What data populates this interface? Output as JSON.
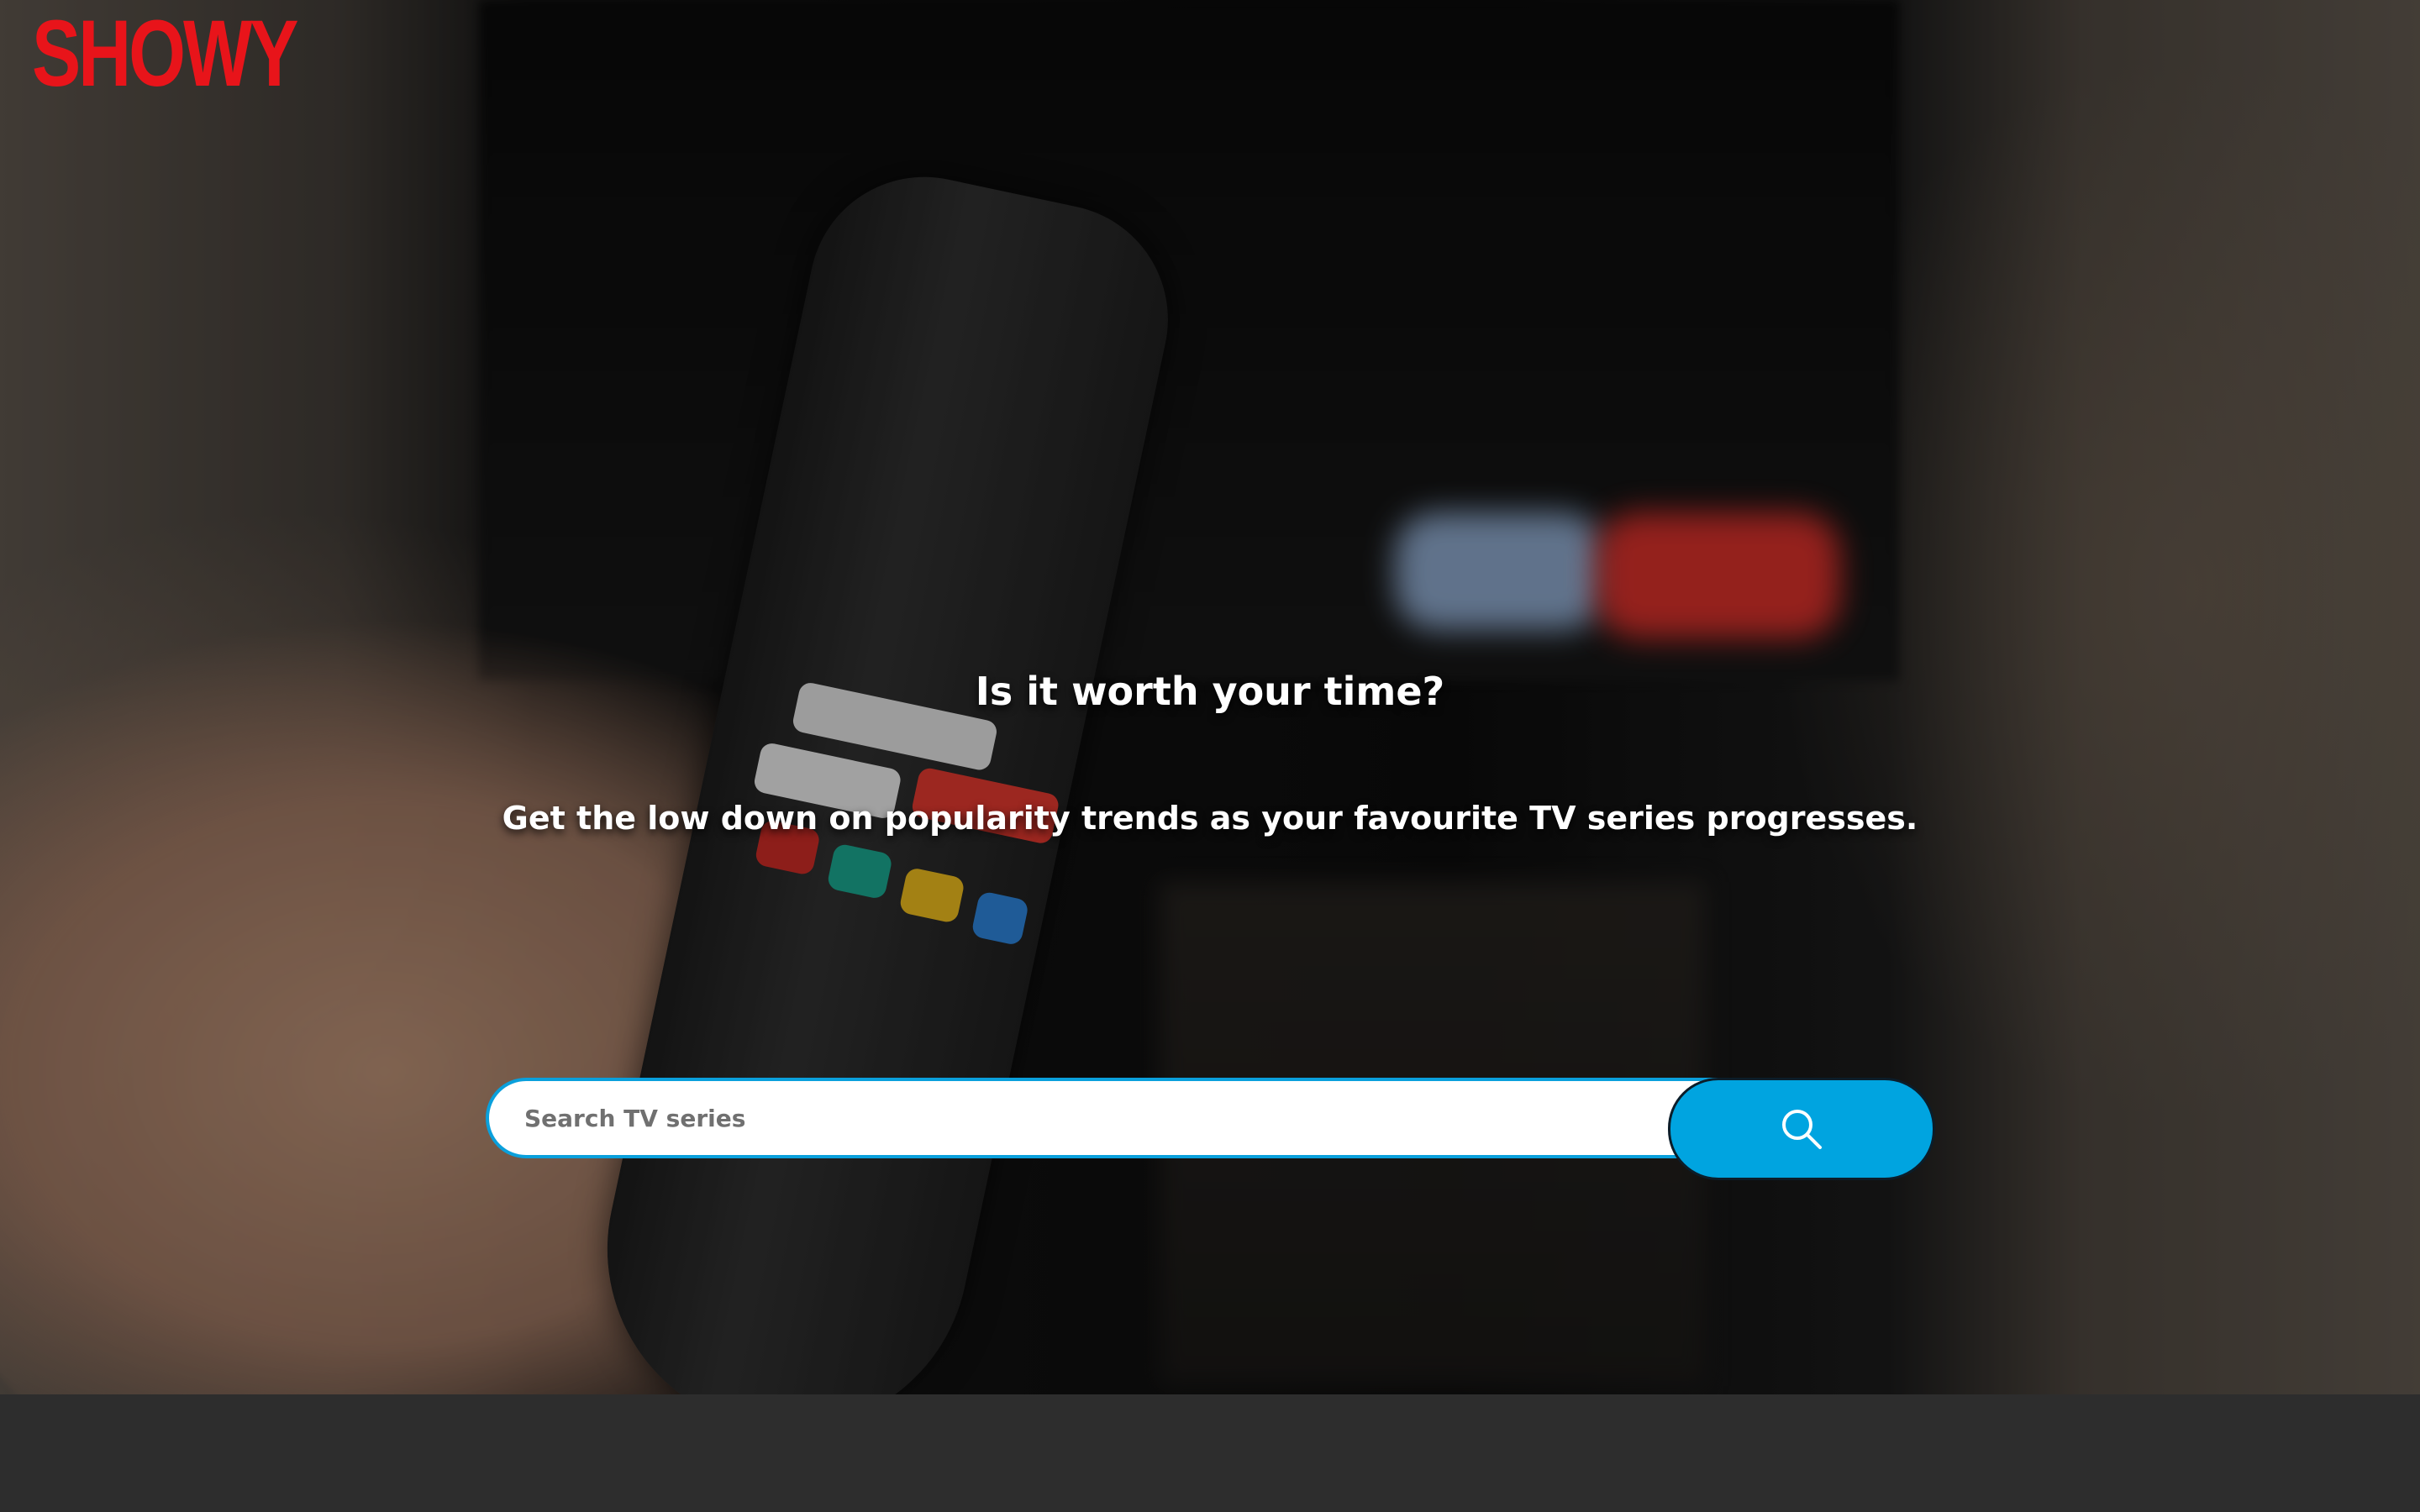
{
  "brand": {
    "logo_text": "SHOWY",
    "logo_color": "#e8141a"
  },
  "hero": {
    "headline": "Is it worth your time?",
    "subheadline": "Get the low down on popularity trends as your favourite TV series progresses."
  },
  "search": {
    "placeholder": "Search TV series",
    "value": "",
    "button_icon": "search-icon",
    "accent_color": "#00a4e0"
  },
  "footer": {
    "background_color": "#2d2d2d"
  }
}
